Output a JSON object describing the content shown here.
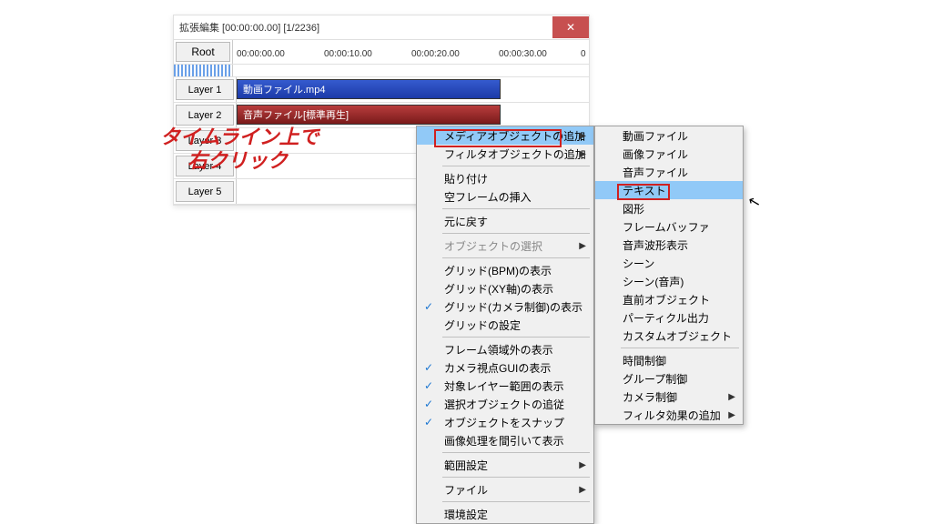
{
  "window": {
    "title": "拡張編集 [00:00:00.00] [1/2236]"
  },
  "header": {
    "root": "Root"
  },
  "ruler": {
    "labels": [
      "00:00:00.00",
      "00:00:10.00",
      "00:00:20.00",
      "00:00:30.00",
      "0"
    ]
  },
  "tracks": [
    {
      "label": "Layer 1",
      "clip": "動画ファイル.mp4",
      "type": "video"
    },
    {
      "label": "Layer 2",
      "clip": "音声ファイル[標準再生]",
      "type": "audio"
    },
    {
      "label": "Layer 3"
    },
    {
      "label": "Layer 4"
    },
    {
      "label": "Layer 5"
    }
  ],
  "annotation": {
    "line1": "タイムライン上で",
    "line2": "右クリック"
  },
  "menu_left": {
    "media_add": "メディアオブジェクトの追加",
    "filter_add": "フィルタオブジェクトの追加",
    "paste": "貼り付け",
    "insert_blank": "空フレームの挿入",
    "undo": "元に戻す",
    "object_select": "オブジェクトの選択",
    "grid_bpm": "グリッド(BPM)の表示",
    "grid_xy": "グリッド(XY軸)の表示",
    "grid_camera": "グリッド(カメラ制御)の表示",
    "grid_settings": "グリッドの設定",
    "frame_out": "フレーム領域外の表示",
    "camera_gui": "カメラ視点GUIの表示",
    "layer_range": "対象レイヤー範囲の表示",
    "follow_sel": "選択オブジェクトの追従",
    "snap": "オブジェクトをスナップ",
    "thinning": "画像処理を間引いて表示",
    "range": "範囲設定",
    "file": "ファイル",
    "env": "環境設定"
  },
  "menu_right": {
    "video": "動画ファイル",
    "image": "画像ファイル",
    "audio": "音声ファイル",
    "text": "テキスト",
    "shape": "図形",
    "framebuf": "フレームバッファ",
    "waveform": "音声波形表示",
    "scene": "シーン",
    "scene_audio": "シーン(音声)",
    "prev_obj": "直前オブジェクト",
    "particle": "パーティクル出力",
    "custom": "カスタムオブジェクト",
    "time_ctrl": "時間制御",
    "group_ctrl": "グループ制御",
    "camera_ctrl": "カメラ制御",
    "filter_effect": "フィルタ効果の追加"
  }
}
